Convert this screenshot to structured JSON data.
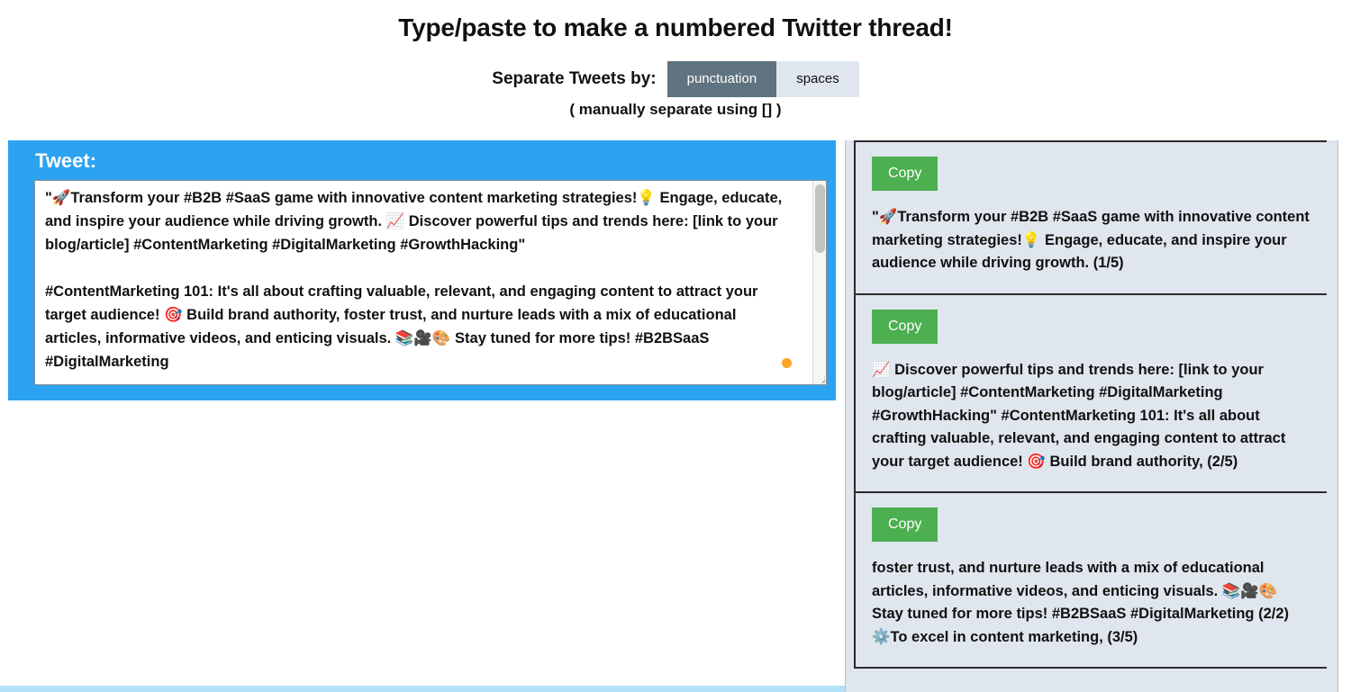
{
  "header": {
    "title": "Type/paste to make a numbered Twitter thread!",
    "separator_label": "Separate Tweets by:",
    "options": [
      {
        "label": "punctuation",
        "active": true
      },
      {
        "label": "spaces",
        "active": false
      }
    ],
    "hint": "( manually separate using [] )"
  },
  "editor": {
    "label": "Tweet:",
    "value": "\"🚀Transform your #B2B #SaaS game with innovative content marketing strategies!💡 Engage, educate, and inspire your audience while driving growth. 📈 Discover powerful tips and trends here: [link to your blog/article] #ContentMarketing #DigitalMarketing #GrowthHacking\"\n\n#ContentMarketing 101: It's all about crafting valuable, relevant, and engaging content to attract your target audience! 🎯 Build brand authority, foster trust, and nurture leads with a mix of educational articles, informative videos, and enticing visuals. 📚🎥🎨 Stay tuned for more tips! #B2BSaaS #DigitalMarketing",
    "placeholder": "",
    "status_dot_color": "#fca423"
  },
  "results": {
    "copy_label": "Copy",
    "tweets": [
      {
        "copy_label": "Copy",
        "text": "\"🚀Transform your #B2B #SaaS game with innovative content marketing strategies!💡 Engage, educate, and inspire your audience while driving growth. (1/5)"
      },
      {
        "copy_label": "Copy",
        "text": "📈 Discover powerful tips and trends here: [link to your blog/article] #ContentMarketing #DigitalMarketing #GrowthHacking\" #ContentMarketing 101: It's all about crafting valuable, relevant, and engaging content to attract your target audience! 🎯 Build brand authority, (2/5)"
      },
      {
        "copy_label": "Copy",
        "text": "foster trust, and nurture leads with a mix of educational articles, informative videos, and enticing visuals. 📚🎥🎨 Stay tuned for more tips! #B2BSaaS #DigitalMarketing (2/2) ⚙️To excel in content marketing, (3/5)"
      }
    ]
  },
  "colors": {
    "accent_blue": "#2ba3f0",
    "copy_green": "#4caf50",
    "active_segment": "#5f7380",
    "inactive_segment": "#dfe6ed",
    "panel_background": "#dfe6ed",
    "status_dot": "#fca423",
    "bottom_band": "#b2e2f8"
  }
}
